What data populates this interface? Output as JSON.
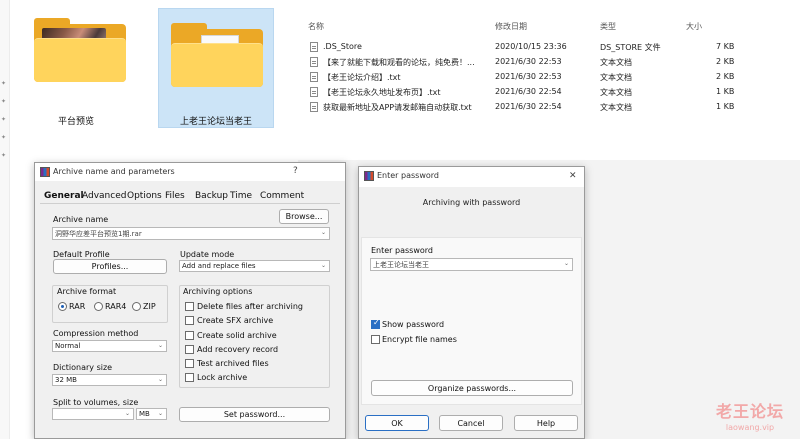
{
  "folders": [
    {
      "label": "平台预览"
    },
    {
      "label": "上老王论坛当老王"
    }
  ],
  "file_list": {
    "columns": {
      "name": "名称",
      "modified": "修改日期",
      "type": "类型",
      "size": "大小"
    },
    "rows": [
      {
        "name": ".DS_Store",
        "modified": "2020/10/15 23:36",
        "type": "DS_STORE 文件",
        "size": "7 KB"
      },
      {
        "name": "【来了就能下载和观看的论坛，纯免费！...",
        "modified": "2021/6/30 22:53",
        "type": "文本文档",
        "size": "2 KB"
      },
      {
        "name": "【老王论坛介绍】.txt",
        "modified": "2021/6/30 22:53",
        "type": "文本文档",
        "size": "2 KB"
      },
      {
        "name": "【老王论坛永久地址发布页】.txt",
        "modified": "2021/6/30 22:54",
        "type": "文本文档",
        "size": "1 KB"
      },
      {
        "name": "获取最新地址及APP请发邮箱自动获取.txt",
        "modified": "2021/6/30 22:54",
        "type": "文本文档",
        "size": "1 KB"
      }
    ]
  },
  "archive_dialog": {
    "title": "Archive name and parameters",
    "help_glyph": "?",
    "tabs": [
      "General",
      "Advanced",
      "Options",
      "Files",
      "Backup",
      "Time",
      "Comment"
    ],
    "archive_name_label": "Archive name",
    "browse_label": "Browse...",
    "archive_name_value": "洞野华应差平台预览1期.rar",
    "default_profile_label": "Default Profile",
    "profiles_label": "Profiles...",
    "update_mode_label": "Update mode",
    "update_mode_value": "Add and replace files",
    "archive_format_label": "Archive format",
    "formats": [
      "RAR",
      "RAR4",
      "ZIP"
    ],
    "selected_format": "RAR",
    "compression_method_label": "Compression method",
    "compression_method_value": "Normal",
    "dictionary_size_label": "Dictionary size",
    "dictionary_size_value": "32 MB",
    "split_label": "Split to volumes, size",
    "split_unit": "MB",
    "archiving_options_label": "Archiving options",
    "options": [
      {
        "label": "Delete files after archiving",
        "checked": false
      },
      {
        "label": "Create SFX archive",
        "checked": false
      },
      {
        "label": "Create solid archive",
        "checked": false
      },
      {
        "label": "Add recovery record",
        "checked": false
      },
      {
        "label": "Test archived files",
        "checked": false
      },
      {
        "label": "Lock archive",
        "checked": false
      }
    ],
    "set_password_label": "Set password..."
  },
  "password_dialog": {
    "title": "Enter password",
    "close_glyph": "✕",
    "subtitle": "Archiving with password",
    "enter_password_label": "Enter password",
    "password_value": "上老王论坛当老王",
    "show_password_label": "Show password",
    "show_password_checked": true,
    "encrypt_names_label": "Encrypt file names",
    "encrypt_names_checked": false,
    "organize_label": "Organize passwords...",
    "ok_label": "OK",
    "cancel_label": "Cancel",
    "help_label": "Help"
  },
  "watermark": {
    "line1": "老王论坛",
    "line2": "laowang.vip"
  },
  "colors": {
    "selection": "#cce4f7",
    "folder": "#ffd45c",
    "checkbox_on": "#2a6fc4",
    "watermark": "#f2a8a8"
  }
}
